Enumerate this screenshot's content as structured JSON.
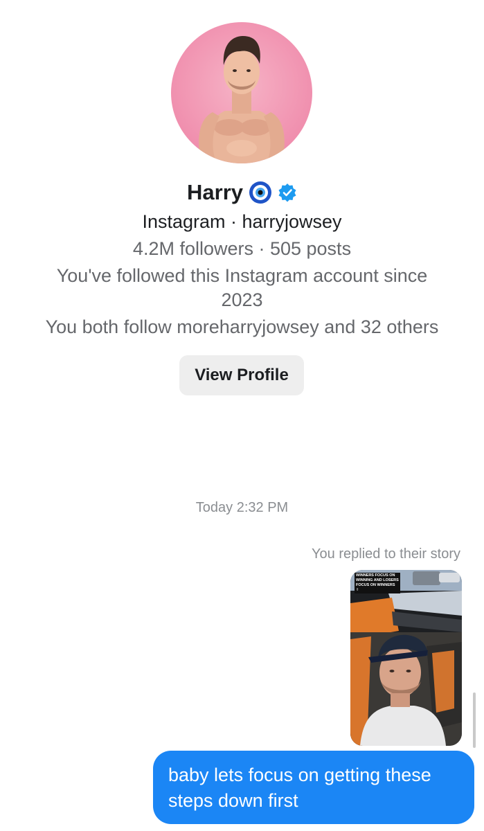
{
  "profile": {
    "name": "Harry",
    "emoji": "🧿",
    "platform_line": "Instagram · harryjowsey",
    "stats_line": "4.2M followers · 505 posts",
    "followed_since_line1": "You've followed this Instagram account since",
    "followed_since_line2": "2023",
    "mutuals_line": "You both follow moreharryjowsey and 32 others",
    "view_profile_label": "View Profile",
    "verified_color": "#1d9bf0"
  },
  "conversation": {
    "timestamp": "Today 2:32 PM",
    "reply_context": "You replied to their story",
    "story_caption": "WINNERS FOCUS ON WINNING AND LOSERS FOCUS ON WINNERS ✌",
    "message": "baby lets focus on getting these steps down first",
    "bubble_color": "#1b86f5"
  },
  "icons": {
    "avatar": "profile-photo",
    "verified": "verified-badge-icon",
    "story": "story-thumbnail"
  }
}
